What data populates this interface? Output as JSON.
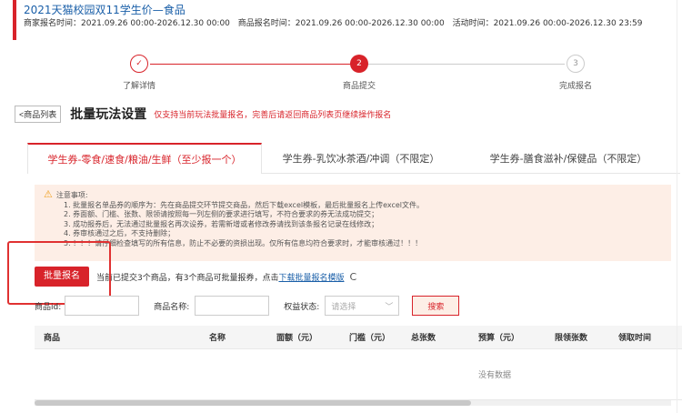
{
  "header": {
    "title": "2021天猫校园双11学生价—食品",
    "merchant_signup": "商家报名时间：2021.09.26 00:00-2026.12.30 00:00",
    "product_signup": "商品报名时间：2021.09.26 00:00-2026.12.30 00:00",
    "activity_time": "活动时间：2021.09.26 00:00-2026.12.30 23:59"
  },
  "steps": [
    {
      "num": "✓",
      "label": "了解详情",
      "state": "done"
    },
    {
      "num": "2",
      "label": "商品提交",
      "state": "active"
    },
    {
      "num": "3",
      "label": "完成报名",
      "state": "todo"
    }
  ],
  "toolbar": {
    "back_label": "<商品列表",
    "title": "批量玩法设置",
    "note": "仅支持当前玩法批量报名，完善后请返回商品列表页继续操作报名"
  },
  "tabs": [
    {
      "label": "学生券-零食/速食/粮油/生鲜（至少报一个）",
      "active": true
    },
    {
      "label": "学生券-乳饮冰茶酒/冲调（不限定）",
      "active": false
    },
    {
      "label": "学生券-膳食滋补/保健品（不限定）",
      "active": false
    }
  ],
  "notice": {
    "heading": "注意事项:",
    "items": [
      "1. 批量报名单品券的顺序为：先在商品提交环节提交商品，然后下载excel模板，最后批量报名上传excel文件。",
      "2. 券面额、门槛、张数、限领请按照每一列左侧的要求进行填写，不符合要求的券无法成功提交；",
      "3. 成功报券后，无法通过批量报名再次设券，若需新增或者修改券请找到该条报名记录在线修改；",
      "4. 券审核通过之后，不支持删除；",
      "5. ！！！请仔细检查填写的所有信息，防止不必要的资损出现。仅所有信息均符合要求时，才能审核通过！！！"
    ]
  },
  "actions": {
    "batch_label": "批量报名",
    "status_text": "当前已提交3个商品，有3个商品可批量报券，点击",
    "download_link": "下载批量报名模版",
    "refresh_icon": "C"
  },
  "filters": {
    "id_label": "商品id:",
    "name_label": "商品名称:",
    "status_label": "权益状态:",
    "status_placeholder": "请选择",
    "search_label": "搜索"
  },
  "table": {
    "columns": [
      "商品",
      "名称",
      "面额（元）",
      "门槛（元）",
      "总张数",
      "预算（元）",
      "限领张数",
      "领取时间"
    ],
    "empty_text": "没有数据"
  },
  "colors": {
    "accent": "#d8232a",
    "link": "#1a5fa8",
    "notice_bg": "#fdeee6"
  }
}
